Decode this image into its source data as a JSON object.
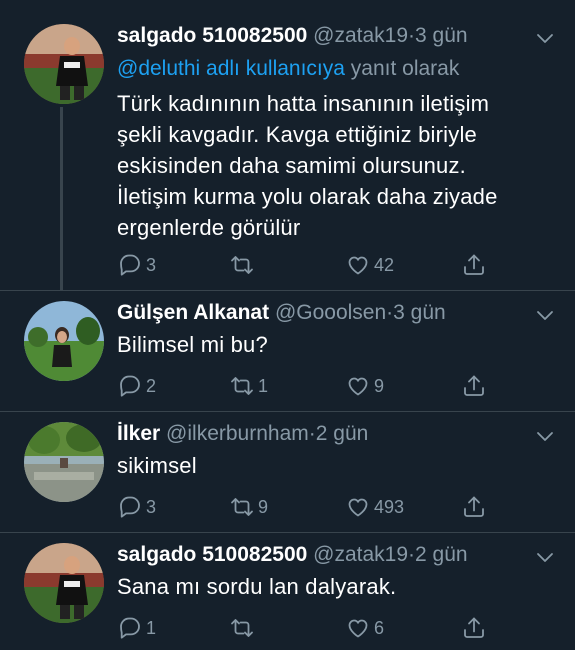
{
  "tweets": [
    {
      "name": "salgado 510082500",
      "handle": "@zatak19",
      "dot": "·",
      "time": "3 gün",
      "reply_prefix": "@deluthi adlı kullanıcıya",
      "reply_suffix": " yanıt olarak",
      "text_lines": [
        "Türk kadınının hatta insanının iletişim",
        "şekli kavgadır. Kavga ettiğiniz biriyle",
        "eskisinden daha samimi olursunuz.",
        "İletişim kurma yolu olarak daha ziyade",
        "ergenlerde görülür"
      ],
      "replies": "3",
      "retweets": "",
      "likes": "42"
    },
    {
      "name": "Gülşen Alkanat",
      "handle": "@Gooolsen",
      "dot": "·",
      "time": "3 gün",
      "text_lines": [
        "Bilimsel mi bu?"
      ],
      "replies": "2",
      "retweets": "1",
      "likes": "9"
    },
    {
      "name": "İlker",
      "handle": "@ilkerburnham",
      "dot": "·",
      "time": "2 gün",
      "text_lines": [
        "sikimsel"
      ],
      "replies": "3",
      "retweets": "9",
      "likes": "493"
    },
    {
      "name": "salgado 510082500",
      "handle": "@zatak19",
      "dot": "·",
      "time": "2 gün",
      "text_lines": [
        "Sana mı sordu lan dalyarak."
      ],
      "replies": "1",
      "retweets": "",
      "likes": "6"
    }
  ],
  "colors": {
    "background": "#15202b",
    "primary_text": "#ffffff",
    "secondary_text": "#8899a6",
    "link": "#1da1f2",
    "divider": "#38444d"
  },
  "icons": {
    "reply": "reply-icon",
    "retweet": "retweet-icon",
    "like": "heart-icon",
    "share": "share-icon",
    "menu": "chevron-down-icon"
  }
}
